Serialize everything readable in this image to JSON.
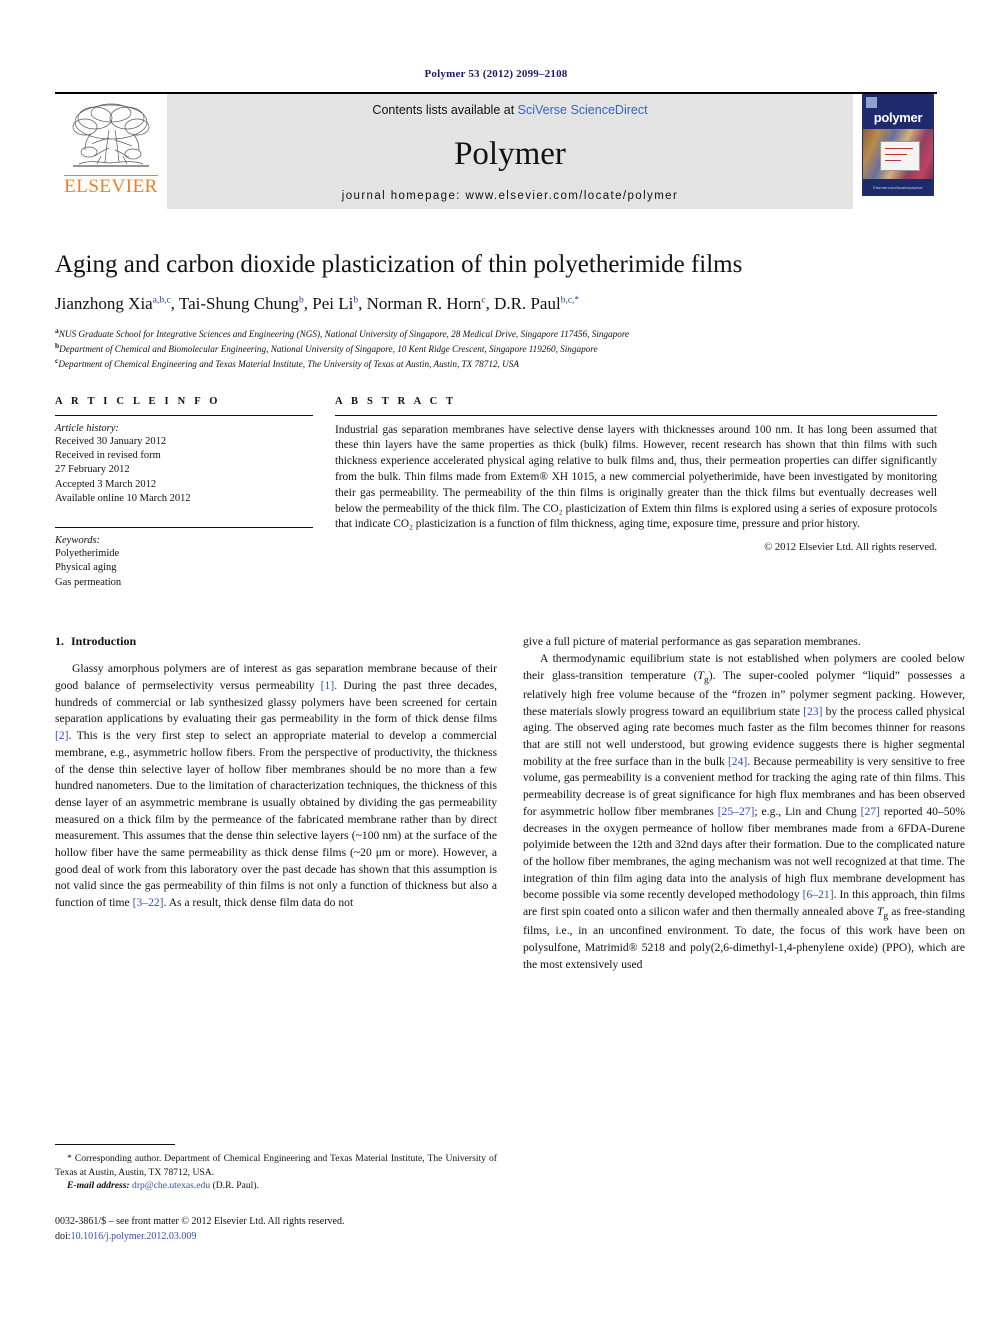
{
  "running_head": "Polymer 53 (2012) 2099–2108",
  "masthead": {
    "publisher": "ELSEVIER",
    "contents_prefix": "Contents lists available at ",
    "contents_link": "SciVerse ScienceDirect",
    "journal_title": "Polymer",
    "homepage": "journal homepage: www.elsevier.com/locate/polymer",
    "cover_title": "polymer",
    "cover_footer": "Elsevier.com/locate/polymer"
  },
  "article": {
    "title": "Aging and carbon dioxide plasticization of thin polyetherimide films",
    "authors": [
      {
        "name": "Jianzhong Xia",
        "marks": "a,b,c"
      },
      {
        "name": "Tai-Shung Chung",
        "marks": "b"
      },
      {
        "name": "Pei Li",
        "marks": "b"
      },
      {
        "name": "Norman R. Horn",
        "marks": "c"
      },
      {
        "name": "D.R. Paul",
        "marks": "b,c,*"
      }
    ],
    "affiliations": [
      {
        "mark": "a",
        "text": "NUS Graduate School for Integrative Sciences and Engineering (NGS), National University of Singapore, 28 Medical Drive, Singapore 117456, Singapore"
      },
      {
        "mark": "b",
        "text": "Department of Chemical and Biomolecular Engineering, National University of Singapore, 10 Kent Ridge Crescent, Singapore 119260, Singapore"
      },
      {
        "mark": "c",
        "text": "Department of Chemical Engineering and Texas Material Institute, The University of Texas at Austin, Austin, TX 78712, USA"
      }
    ]
  },
  "article_info": {
    "heading": "A R T I C L E   I N F O",
    "history_label": "Article history:",
    "history": [
      "Received 30 January 2012",
      "Received in revised form",
      "27 February 2012",
      "Accepted 3 March 2012",
      "Available online 10 March 2012"
    ],
    "keywords_label": "Keywords:",
    "keywords": [
      "Polyetherimide",
      "Physical aging",
      "Gas permeation"
    ]
  },
  "abstract": {
    "heading": "A B S T R A C T",
    "text": "Industrial gas separation membranes have selective dense layers with thicknesses around 100 nm. It has long been assumed that these thin layers have the same properties as thick (bulk) films. However, recent research has shown that thin films with such thickness experience accelerated physical aging relative to bulk films and, thus, their permeation properties can differ significantly from the bulk. Thin films made from Extem® XH 1015, a new commercial polyetherimide, have been investigated by monitoring their gas permeability. The permeability of the thin films is originally greater than the thick films but eventually decreases well below the permeability of the thick film. The CO₂ plasticization of Extem thin films is explored using a series of exposure protocols that indicate CO₂ plasticization is a function of film thickness, aging time, exposure time, pressure and prior history.",
    "copyright": "© 2012 Elsevier Ltd. All rights reserved."
  },
  "body": {
    "section_number": "1.",
    "section_title": "Introduction",
    "left_paragraph_1": "Glassy amorphous polymers are of interest as gas separation membrane because of their good balance of permselectivity versus permeability [1]. During the past three decades, hundreds of commercial or lab synthesized glassy polymers have been screened for certain separation applications by evaluating their gas permeability in the form of thick dense films [2]. This is the very first step to select an appropriate material to develop a commercial membrane, e.g., asymmetric hollow fibers. From the perspective of productivity, the thickness of the dense thin selective layer of hollow fiber membranes should be no more than a few hundred nanometers. Due to the limitation of characterization techniques, the thickness of this dense layer of an asymmetric membrane is usually obtained by dividing the gas permeability measured on a thick film by the permeance of the fabricated membrane rather than by direct measurement. This assumes that the dense thin selective layers (~100 nm) at the surface of the hollow fiber have the same permeability as thick dense films (~20 μm or more). However, a good deal of work from this laboratory over the past decade has shown that this assumption is not valid since the gas permeability of thin films is not only a function of thickness but also a function of time [3–22]. As a result, thick dense film data do not",
    "right_paragraph_1": "give a full picture of material performance as gas separation membranes.",
    "right_paragraph_2": "A thermodynamic equilibrium state is not established when polymers are cooled below their glass-transition temperature (Tg). The super-cooled polymer “liquid” possesses a relatively high free volume because of the “frozen in” polymer segment packing. However, these materials slowly progress toward an equilibrium state [23] by the process called physical aging. The observed aging rate becomes much faster as the film becomes thinner for reasons that are still not well understood, but growing evidence suggests there is higher segmental mobility at the free surface than in the bulk [24]. Because permeability is very sensitive to free volume, gas permeability is a convenient method for tracking the aging rate of thin films. This permeability decrease is of great significance for high flux membranes and has been observed for asymmetric hollow fiber membranes [25–27]; e.g., Lin and Chung [27] reported 40–50% decreases in the oxygen permeance of hollow fiber membranes made from a 6FDA-Durene polyimide between the 12th and 32nd days after their formation. Due to the complicated nature of the hollow fiber membranes, the aging mechanism was not well recognized at that time. The integration of thin film aging data into the analysis of high flux membrane development has become possible via some recently developed methodology [6–21]. In this approach, thin films are first spin coated onto a silicon wafer and then thermally annealed above Tg as free-standing films, i.e., in an unconfined environment. To date, the focus of this work have been on polysulfone, Matrimid® 5218 and poly(2,6-dimethyl-1,4-phenylene oxide) (PPO), which are the most extensively used"
  },
  "footnote": {
    "corresponding": "* Corresponding author. Department of Chemical Engineering and Texas Material Institute, The University of Texas at Austin, Austin, TX 78712, USA.",
    "email_label": "E-mail address:",
    "email": "drp@che.utexas.edu",
    "email_owner": "(D.R. Paul)."
  },
  "imprint": {
    "line1": "0032-3861/$ – see front matter © 2012 Elsevier Ltd. All rights reserved.",
    "doi_label": "doi:",
    "doi": "10.1016/j.polymer.2012.03.009"
  },
  "colors": {
    "link": "#2f50b4",
    "running_head": "#1a1a6e",
    "elsevier_orange": "#F47D20",
    "masthead_grey": "#e3e3e3"
  }
}
